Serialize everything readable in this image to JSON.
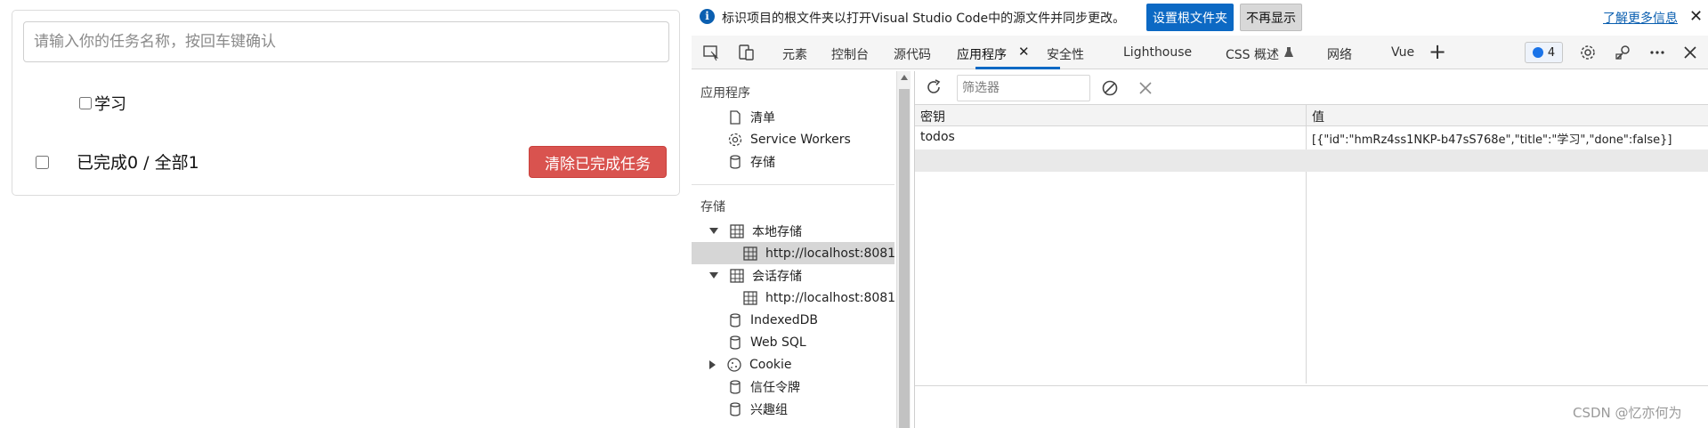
{
  "app": {
    "input_placeholder": "请输入你的任务名称，按回车键确认",
    "todos": [
      {
        "title": "学习",
        "done": false
      }
    ],
    "footer_text": "已完成0 / 全部1",
    "clear_button": "清除已完成任务"
  },
  "devtools": {
    "infobar": {
      "icon": "info-icon",
      "message": "标识项目的根文件夹以打开Visual Studio Code中的源文件并同步更改。",
      "set_root_button": "设置根文件夹",
      "dismiss_button": "不再显示",
      "learn_more": "了解更多信息",
      "close_glyph": "✕"
    },
    "tabs": [
      "元素",
      "控制台",
      "源代码",
      "应用程序",
      "安全性",
      "Lighthouse",
      "CSS 概述",
      "网络",
      "Vue"
    ],
    "active_tab": "应用程序",
    "tab_close_glyph": "✕",
    "add_tab_glyph": "+",
    "issues_count": "4",
    "sidebar": {
      "app_heading": "应用程序",
      "app_items": [
        {
          "label": "清单",
          "icon": "file-icon"
        },
        {
          "label": "Service Workers",
          "icon": "gear-icon"
        },
        {
          "label": "存储",
          "icon": "database-icon"
        }
      ],
      "storage_heading": "存储",
      "local_storage": "本地存储",
      "local_origin": "http://localhost:8081",
      "session_storage": "会话存储",
      "session_origin": "http://localhost:8081",
      "indexeddb": "IndexedDB",
      "websql": "Web SQL",
      "cookie": "Cookie",
      "trust_tokens": "信任令牌",
      "interest_groups": "兴趣组"
    },
    "filter_placeholder": "筛选器",
    "table": {
      "key_header": "密钥",
      "value_header": "值",
      "rows": [
        {
          "key": "todos",
          "value": "[{\"id\":\"hmRz4ss1NKP-b47sS768e\",\"title\":\"学习\",\"done\":false}]"
        }
      ]
    }
  },
  "watermark": "CSDN @忆亦何为",
  "colors": {
    "accent": "#0c69c4",
    "danger": "#d9534f"
  }
}
